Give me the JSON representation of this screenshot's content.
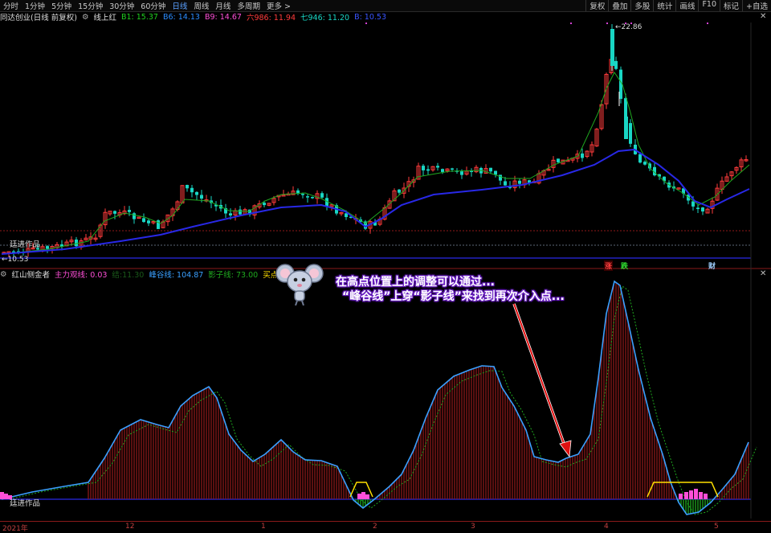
{
  "toolbar": {
    "periods": [
      "分时",
      "1分钟",
      "5分钟",
      "15分钟",
      "30分钟",
      "60分钟",
      "日线",
      "周线",
      "月线",
      "多周期",
      "更多 >"
    ],
    "selected_period": "日线",
    "right_buttons": [
      "复权",
      "叠加",
      "多股",
      "统计",
      "画线",
      "F10",
      "标记",
      "+自选"
    ]
  },
  "main_info": {
    "stock": "同达创业(日线 前复权)",
    "indicator": "线上红",
    "b1": "B1: 15.37",
    "b6": "B6: 14.13",
    "b9": "B9: 14.67",
    "liu": "六986: 11.94",
    "qi": "七946: 11.20",
    "b": "B: 10.53"
  },
  "sub_info": {
    "indicator": "红山侧金者",
    "zlqs": "主力观线: 0.03",
    "bdx": "结:11.30",
    "fgx": "峰谷线: 104.87",
    "yzx": "影子线: 73.00",
    "mdts": "买点提示: 0.00"
  },
  "price_labels": {
    "high": "22.86",
    "low": "10.53"
  },
  "watermark_main": "廷进作品",
  "watermark_sub": "廷进作品",
  "annotation": {
    "line1": "在高点位置上的调整可以通过...",
    "line2": "“峰谷线”上穿“影子线”来找到再次介入点..."
  },
  "tags": {
    "zhang": "涨",
    "die": "跌",
    "cai": "财"
  },
  "date_labels": [
    "2021年",
    "12",
    "1",
    "2",
    "3",
    "4",
    "5"
  ],
  "colors": {
    "up": "#ff3b3b",
    "down": "#19d6c4",
    "ma_short": "#1fa81f",
    "ma_long": "#2828e6",
    "peak": "#3aa0ff",
    "shadow": "#1fa81f",
    "hist": "#8b1a1a",
    "yellow": "#ffe000",
    "pink": "#ff4fd8"
  }
}
